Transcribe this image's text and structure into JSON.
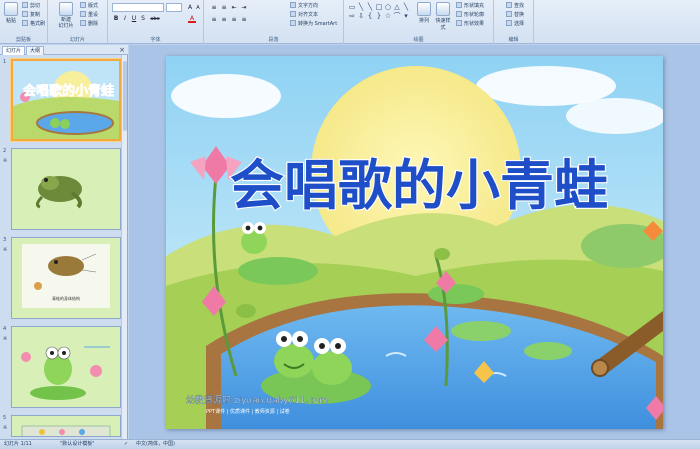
{
  "ribbon": {
    "clipboard": {
      "paste": "粘贴",
      "cut": "剪切",
      "copy": "复制",
      "format_painter": "格式刷",
      "group_label": "剪贴板"
    },
    "slides": {
      "new_slide": "新建\n幻灯片",
      "layout": "版式",
      "reset": "重设",
      "delete": "删除",
      "group_label": "幻灯片"
    },
    "font": {
      "group_label": "字体",
      "bold": "B",
      "italic": "I",
      "underline": "U",
      "shadow": "S",
      "strike": "abe",
      "font_color": "A"
    },
    "paragraph": {
      "text_direction": "文字方向",
      "align_text": "对齐文本",
      "smartart": "转换为 SmartArt",
      "group_label": "段落"
    },
    "drawing": {
      "arrange": "排列",
      "quick_styles": "快速样式",
      "shape_fill": "形状填充",
      "shape_outline": "形状轮廓",
      "shape_effects": "形状效果",
      "group_label": "绘图"
    },
    "editing": {
      "find": "查找",
      "replace": "替换",
      "select": "选择",
      "group_label": "编辑"
    }
  },
  "left_pane": {
    "tabs": [
      "幻灯片",
      "大纲"
    ],
    "close": "×",
    "slides": [
      {
        "number": "1",
        "star": "",
        "title": "会唱歌的小青蛙"
      },
      {
        "number": "2",
        "star": "※"
      },
      {
        "number": "3",
        "star": "※",
        "caption": "青蛙的身体结构"
      },
      {
        "number": "4",
        "star": "※"
      },
      {
        "number": "5",
        "star": "※"
      }
    ]
  },
  "slide": {
    "title": "会唱歌的小青蛙",
    "watermark_main": "幼教资源网 ziyuan.baby611.com",
    "watermark_sub": "PPT课件 | 优质课件 | 教师资源 | 试卷"
  },
  "status_bar": {
    "slide_count": "幻灯片 1/11",
    "theme": "\"默认设计模板\"",
    "language": "中文(简体，中国)"
  },
  "colors": {
    "title_fill": "#1e4ec8",
    "selection": "#f4a93f",
    "pond": "#5aa8ea"
  }
}
